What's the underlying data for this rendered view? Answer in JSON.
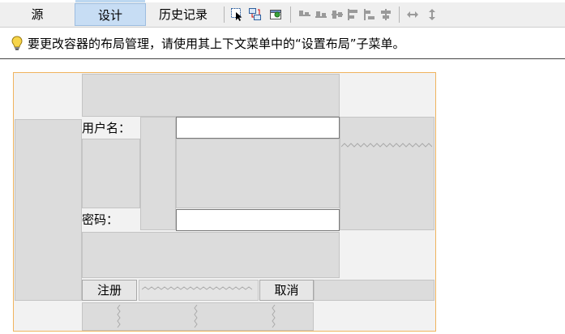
{
  "toolbar": {
    "tabs": [
      {
        "label": "源",
        "active": false
      },
      {
        "label": "设计",
        "active": true
      },
      {
        "label": "历史记录",
        "active": false
      }
    ],
    "icons": [
      "selection-mode-icon",
      "connection-mode-icon",
      "preview-design-icon",
      "align-left-icon",
      "align-right-icon",
      "center-horizontally-icon",
      "align-top-icon",
      "align-bottom-icon",
      "center-vertically-icon",
      "change-horizontal-resizability-icon",
      "change-vertical-resizability-icon"
    ],
    "accent_color": "#c7ddf4"
  },
  "hint": {
    "icon": "lightbulb-icon",
    "text": "要更改容器的布局管理，请使用其上下文菜单中的“设置布局”子菜单。"
  },
  "form": {
    "username_label": "用户名：",
    "username_value": "",
    "password_label": "密码：",
    "password_value": "",
    "register_button": "注册",
    "cancel_button": "取消",
    "selection_color": "#f0b45e"
  }
}
